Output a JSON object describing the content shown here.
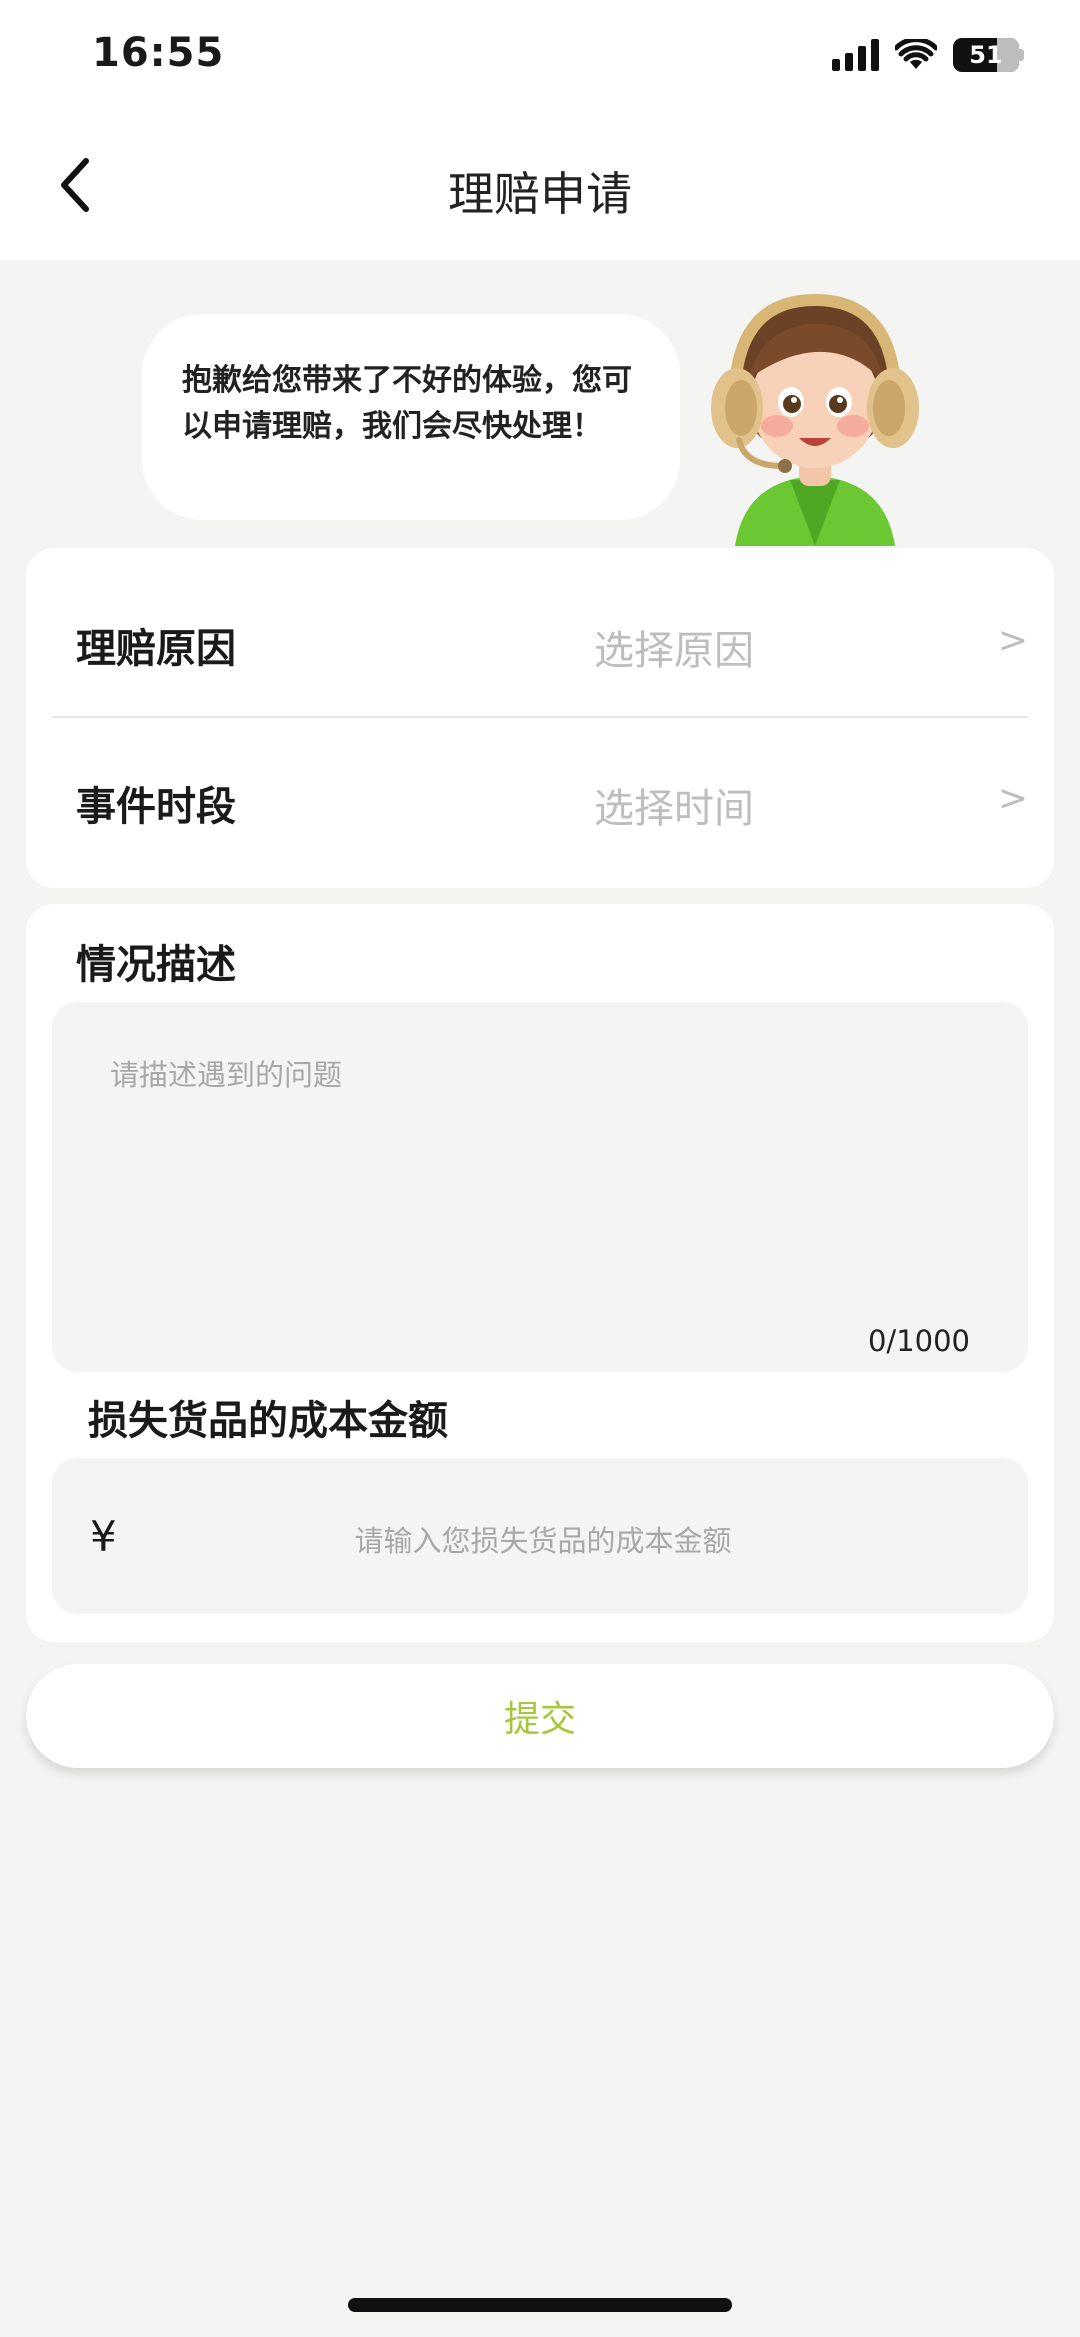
{
  "status_bar": {
    "time": "16:55",
    "battery": "51",
    "icons": [
      "signal-icon",
      "wifi-icon",
      "battery-icon"
    ]
  },
  "nav": {
    "title": "理赔申请",
    "back_icon": "chevron-left-icon"
  },
  "hero": {
    "message": "抱歉给您带来了不好的体验，您可以申请理赔，我们会尽快处理！",
    "avatar": "customer-service-avatar"
  },
  "claim_form": {
    "reason": {
      "label": "理赔原因",
      "placeholder": "选择原因",
      "chevron": ">"
    },
    "period": {
      "label": "事件时段",
      "placeholder": "选择时间",
      "chevron": ">"
    },
    "description": {
      "title": "情况描述",
      "placeholder": "请描述遇到的问题",
      "count": "0/1000"
    },
    "amount": {
      "title": "损失货品的成本金额",
      "currency": "¥",
      "placeholder": "请输入您损失货品的成本金额"
    }
  },
  "submit_label": "提交",
  "colors": {
    "background": "#f4f4f2",
    "card": "#ffffff",
    "accent": "#a7c73a",
    "placeholder": "#bdbdbd"
  }
}
